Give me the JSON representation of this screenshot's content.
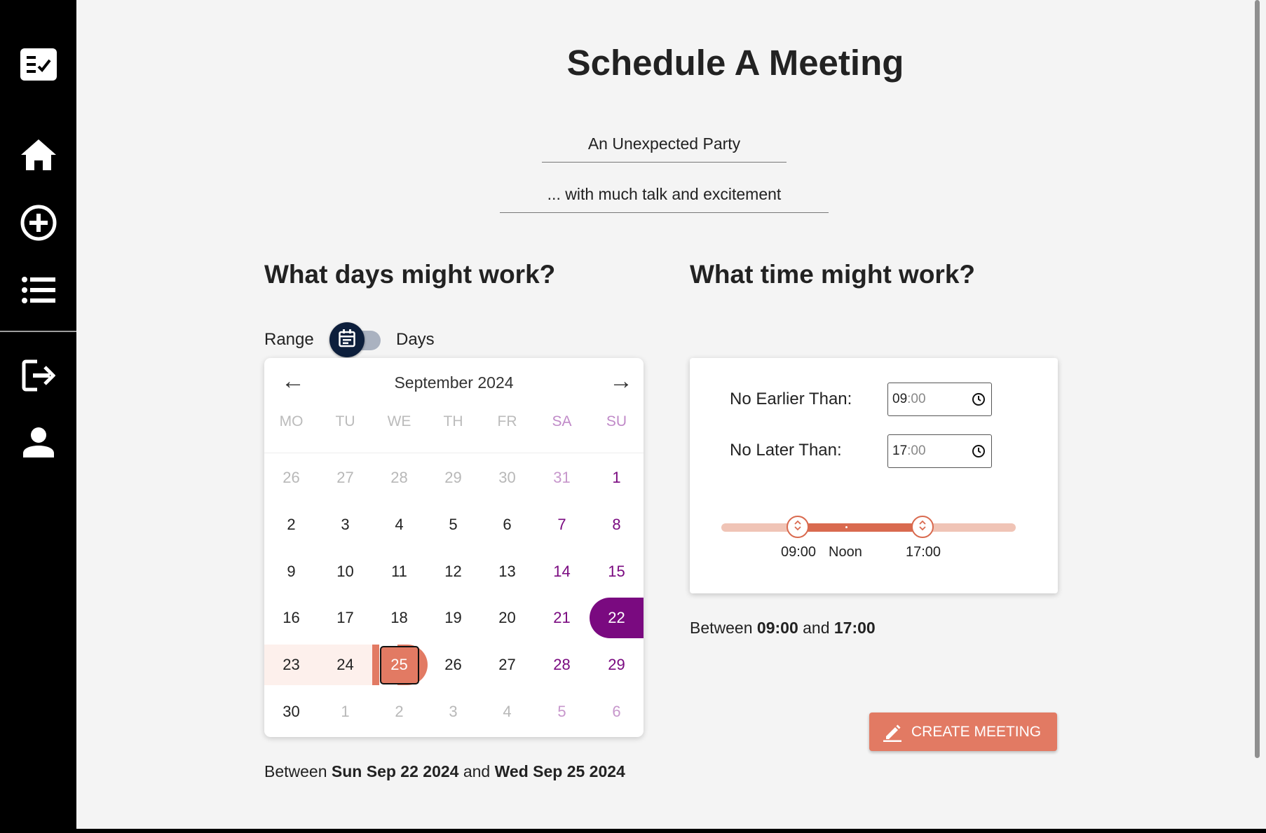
{
  "sidebar": {
    "icons": [
      "checklist-icon",
      "home-icon",
      "add-circle-icon",
      "list-icon",
      "logout-icon",
      "person-icon"
    ]
  },
  "page": {
    "title": "Schedule A Meeting",
    "meeting_name": "An Unexpected Party",
    "meeting_description": "... with much talk and excitement"
  },
  "days": {
    "heading": "What days might work?",
    "toggle_left": "Range",
    "toggle_right": "Days",
    "calendar": {
      "month": "September",
      "year": "2024",
      "prev": "←",
      "next": "→",
      "weekdays": [
        "MO",
        "TU",
        "WE",
        "TH",
        "FR",
        "SA",
        "SU"
      ],
      "weeks": [
        [
          "26",
          "27",
          "28",
          "29",
          "30",
          "31",
          "1"
        ],
        [
          "2",
          "3",
          "4",
          "5",
          "6",
          "7",
          "8"
        ],
        [
          "9",
          "10",
          "11",
          "12",
          "13",
          "14",
          "15"
        ],
        [
          "16",
          "17",
          "18",
          "19",
          "20",
          "21",
          "22"
        ],
        [
          "23",
          "24",
          "25",
          "26",
          "27",
          "28",
          "29"
        ],
        [
          "30",
          "1",
          "2",
          "3",
          "4",
          "5",
          "6"
        ]
      ],
      "range_start": "22",
      "range_end": "25"
    },
    "summary_prefix": "Between",
    "summary_start": "Sun Sep 22 2024",
    "summary_and": "and",
    "summary_end": "Wed Sep 25 2024"
  },
  "time": {
    "heading": "What time might work?",
    "earliest_label": "No Earlier Than:",
    "earliest_hh": "09",
    "earliest_mm": "00",
    "latest_label": "No Later Than:",
    "latest_hh": "17",
    "latest_mm": "00",
    "slider": {
      "start_label": "09:00",
      "mid_label": "Noon",
      "end_label": "17:00"
    },
    "summary_prefix": "Between",
    "summary_start": "09:00",
    "summary_and": "and",
    "summary_end": "17:00"
  },
  "actions": {
    "create_label": "CREATE MEETING"
  },
  "colors": {
    "accent": "#e27a63",
    "range_purple": "#7a0a80",
    "toggle_dark": "#0d1f3c"
  }
}
